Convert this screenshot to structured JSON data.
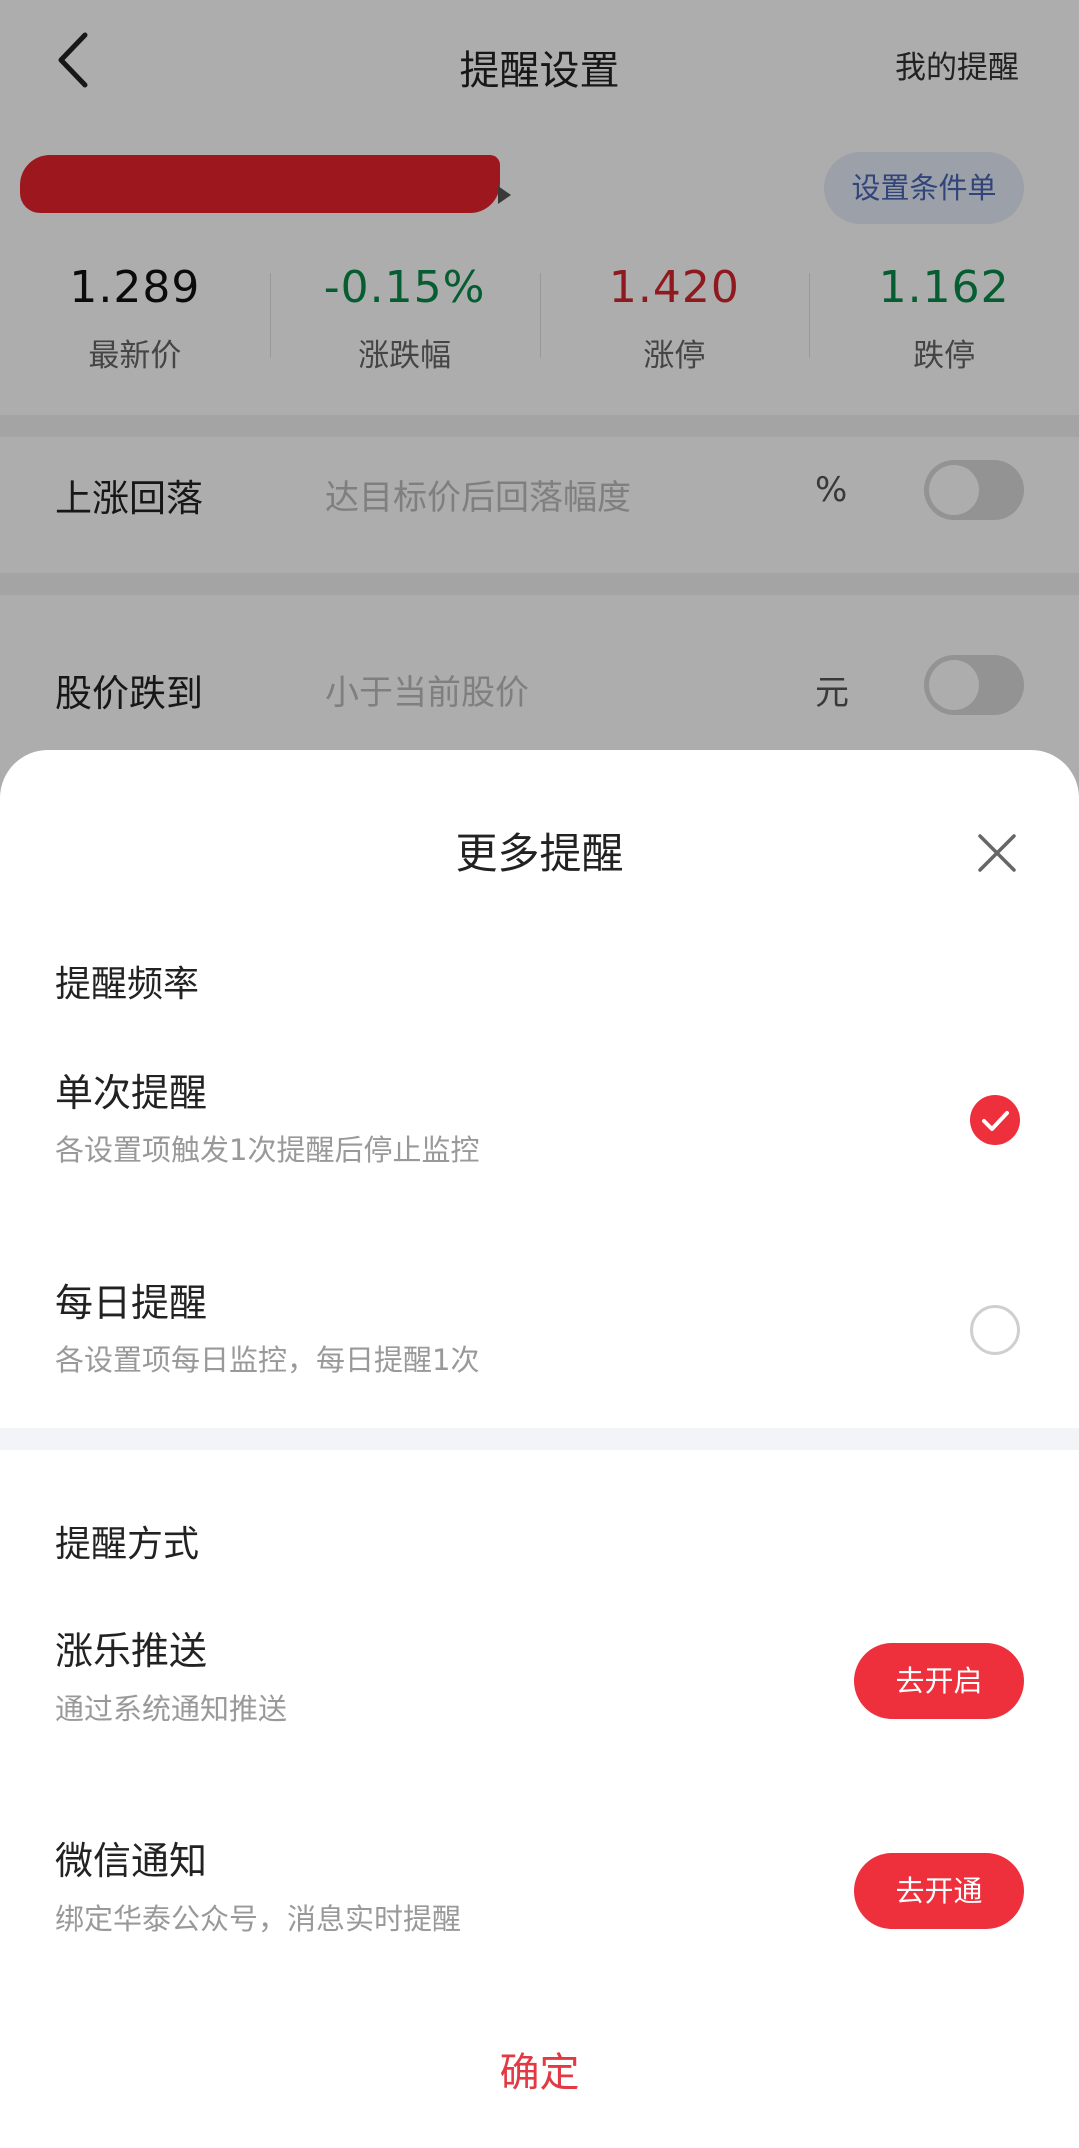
{
  "header": {
    "title": "提醒设置",
    "right_link": "我的提醒"
  },
  "stock": {
    "condition_button": "设置条件单"
  },
  "quotes": [
    {
      "value": "1.289",
      "label": "最新价",
      "tone": "black"
    },
    {
      "value": "-0.15%",
      "label": "涨跌幅",
      "tone": "green"
    },
    {
      "value": "1.420",
      "label": "涨停",
      "tone": "red"
    },
    {
      "value": "1.162",
      "label": "跌停",
      "tone": "green"
    }
  ],
  "rows": [
    {
      "label": "上涨回落",
      "placeholder": "达目标价后回落幅度",
      "unit": "%",
      "enabled": false
    },
    {
      "label": "股价跌到",
      "placeholder": "小于当前股价",
      "unit": "元",
      "enabled": false
    }
  ],
  "sheet": {
    "title": "更多提醒",
    "frequency": {
      "title": "提醒频率",
      "options": [
        {
          "title": "单次提醒",
          "desc": "各设置项触发1次提醒后停止监控",
          "selected": true
        },
        {
          "title": "每日提醒",
          "desc": "各设置项每日监控，每日提醒1次",
          "selected": false
        }
      ]
    },
    "method": {
      "title": "提醒方式",
      "options": [
        {
          "title": "涨乐推送",
          "desc": "通过系统通知推送",
          "button": "去开启"
        },
        {
          "title": "微信通知",
          "desc": "绑定华泰公众号，消息实时提醒",
          "button": "去开通"
        }
      ]
    },
    "confirm": "确定"
  },
  "colors": {
    "accent_red": "#ee2f3c",
    "price_up": "#d5262f",
    "price_down": "#0a8a4a"
  }
}
